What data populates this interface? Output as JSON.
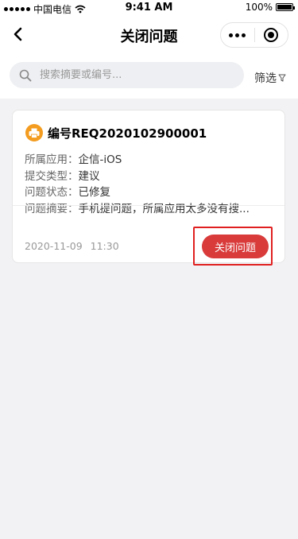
{
  "status_bar": {
    "carrier": "中国电信",
    "time": "9:41 AM",
    "battery": "100%",
    "battery_level": 1.0
  },
  "nav": {
    "title": "关闭问题",
    "back_icon": "chevron-left-icon",
    "more_icon": "more-dots-icon",
    "close_icon": "target-icon"
  },
  "search": {
    "placeholder": "搜索摘要或编号...",
    "value": "",
    "filter_label": "筛选",
    "filter_icon": "funnel-icon"
  },
  "card": {
    "title": "编号REQ2020102900001",
    "icon": "printer-icon",
    "icon_color": "#f39c1f",
    "fields": [
      {
        "label": "所属应用：",
        "value": "企信-iOS"
      },
      {
        "label": "提交类型：",
        "value": "建议"
      },
      {
        "label": "问题状态：",
        "value": "已修复"
      },
      {
        "label": "问题摘要：",
        "value": "手机提问题，所属应用太多没有搜..."
      }
    ],
    "date": "2020-11-09",
    "time": "11:30",
    "action_label": "关闭问题",
    "action_color": "#d93a3a",
    "highlight_color": "#e02020"
  }
}
